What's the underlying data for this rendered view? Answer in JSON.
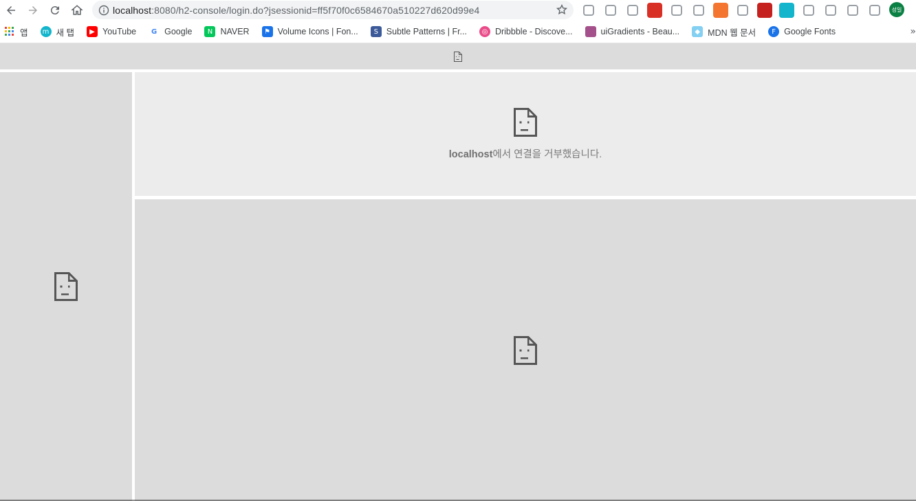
{
  "browser": {
    "url_host": "localhost",
    "url_path": ":8080/h2-console/login.do?jsessionid=ff5f70f0c6584670a510227d620d99e4",
    "profile_initials": "성일",
    "extensions": [
      {
        "name": "pdf-extension-icon",
        "color": "#e8eaed"
      },
      {
        "name": "eyedropper-extension-icon",
        "color": "#e8eaed"
      },
      {
        "name": "hammer-extension-icon",
        "color": "#e8eaed"
      },
      {
        "name": "counter-extension-icon",
        "color": "#d93025"
      },
      {
        "name": "grid-extension-icon",
        "color": "#e8eaed"
      },
      {
        "name": "color-picker-extension-icon",
        "color": "#e8eaed"
      },
      {
        "name": "ex-extension-icon",
        "color": "#f4752f"
      },
      {
        "name": "window-extension-icon",
        "color": "#e8eaed"
      },
      {
        "name": "forward-extension-icon",
        "color": "#c5221f"
      },
      {
        "name": "m-extension-icon",
        "color": "#12b5cb"
      },
      {
        "name": "gear-extension-icon",
        "color": "#e8eaed"
      },
      {
        "name": "sheet-extension-icon",
        "color": "#e8eaed"
      },
      {
        "name": "puzzle-extension-icon",
        "color": "#e8eaed"
      },
      {
        "name": "playlist-extension-icon",
        "color": "#e8eaed"
      }
    ]
  },
  "bookmarks": [
    {
      "label": "앱",
      "icon": "apps-grid-icon",
      "color": "#ea4335",
      "glyph": ""
    },
    {
      "label": "새 탭",
      "icon": "new-tab-icon",
      "color": "#12b5cb",
      "glyph": "m"
    },
    {
      "label": "YouTube",
      "icon": "youtube-icon",
      "color": "#ff0000",
      "glyph": "▶"
    },
    {
      "label": "Google",
      "icon": "google-icon",
      "color": "#ffffff",
      "glyph": "G"
    },
    {
      "label": "NAVER",
      "icon": "naver-icon",
      "color": "#03c75a",
      "glyph": "N"
    },
    {
      "label": "Volume Icons | Fon...",
      "icon": "flag-icon",
      "color": "#1a73e8",
      "glyph": "⚑"
    },
    {
      "label": "Subtle Patterns | Fr...",
      "icon": "subtle-patterns-icon",
      "color": "#3c5a99",
      "glyph": "S"
    },
    {
      "label": "Dribbble - Discove...",
      "icon": "dribbble-icon",
      "color": "#ea4c89",
      "glyph": "◎"
    },
    {
      "label": "uiGradients - Beau...",
      "icon": "uigradients-icon",
      "color": "#a4508b",
      "glyph": ""
    },
    {
      "label": "MDN 웹 문서",
      "icon": "mdn-icon",
      "color": "#83d0f2",
      "glyph": "◆"
    },
    {
      "label": "Google Fonts",
      "icon": "google-fonts-icon",
      "color": "#1a73e8",
      "glyph": "F"
    }
  ],
  "frames": {
    "error_host": "localhost",
    "error_message": "에서 연결을 거부했습니다."
  }
}
